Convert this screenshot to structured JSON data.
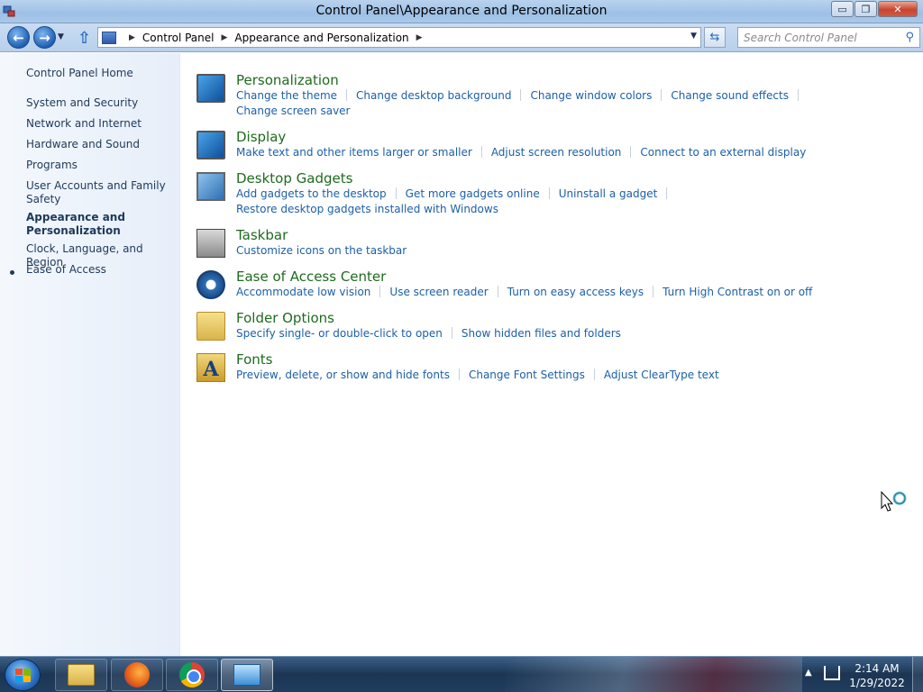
{
  "window": {
    "title": "Control Panel\\Appearance and Personalization",
    "minimize_glyph": "▭",
    "maximize_glyph": "❐",
    "close_glyph": "✕"
  },
  "address_bar": {
    "back_glyph": "←",
    "forward_glyph": "→",
    "up_glyph": "⇧",
    "breadcrumbs": [
      "Control Panel",
      "Appearance and Personalization"
    ],
    "separator_glyph": "▶",
    "dropdown_glyph": "▼",
    "refresh_glyph": "⇆",
    "search_placeholder": "Search Control Panel",
    "search_glyph": "⚲"
  },
  "left_nav": {
    "home": "Control Panel Home",
    "items": [
      "System and Security",
      "Network and Internet",
      "Hardware and Sound",
      "Programs",
      "User Accounts and Family Safety",
      "Appearance and Personalization",
      "Clock, Language, and Region",
      "Ease of Access"
    ],
    "current_index": 5
  },
  "categories": [
    {
      "title": "Personalization",
      "icon": "personalization-icon",
      "rows": [
        [
          "Change the theme",
          "Change desktop background",
          "Change window colors",
          "Change sound effects"
        ],
        [
          "Change screen saver"
        ]
      ]
    },
    {
      "title": "Display",
      "icon": "display-icon",
      "rows": [
        [
          "Make text and other items larger or smaller",
          "Adjust screen resolution",
          "Connect to an external display"
        ]
      ]
    },
    {
      "title": "Desktop Gadgets",
      "icon": "desktop-gadgets-icon",
      "rows": [
        [
          "Add gadgets to the desktop",
          "Get more gadgets online",
          "Uninstall a gadget"
        ],
        [
          "Restore desktop gadgets installed with Windows"
        ]
      ]
    },
    {
      "title": "Taskbar",
      "icon": "taskbar-icon",
      "rows": [
        [
          "Customize icons on the taskbar"
        ]
      ]
    },
    {
      "title": "Ease of Access Center",
      "icon": "ease-of-access-icon",
      "rows": [
        [
          "Accommodate low vision",
          "Use screen reader",
          "Turn on easy access keys",
          "Turn High Contrast on or off"
        ]
      ]
    },
    {
      "title": "Folder Options",
      "icon": "folder-options-icon",
      "rows": [
        [
          "Specify single- or double-click to open",
          "Show hidden files and folders"
        ]
      ]
    },
    {
      "title": "Fonts",
      "icon": "fonts-icon",
      "rows": [
        [
          "Preview, delete, or show and hide fonts",
          "Change Font Settings",
          "Adjust ClearType text"
        ]
      ]
    }
  ],
  "fonts_icon_glyph": "A",
  "taskbar": {
    "apps": [
      "windows-explorer-icon",
      "firefox-icon",
      "chrome-icon",
      "control-panel-icon"
    ],
    "tray_arrow_glyph": "▲",
    "time": "2:14 AM",
    "date": "1/29/2022"
  }
}
